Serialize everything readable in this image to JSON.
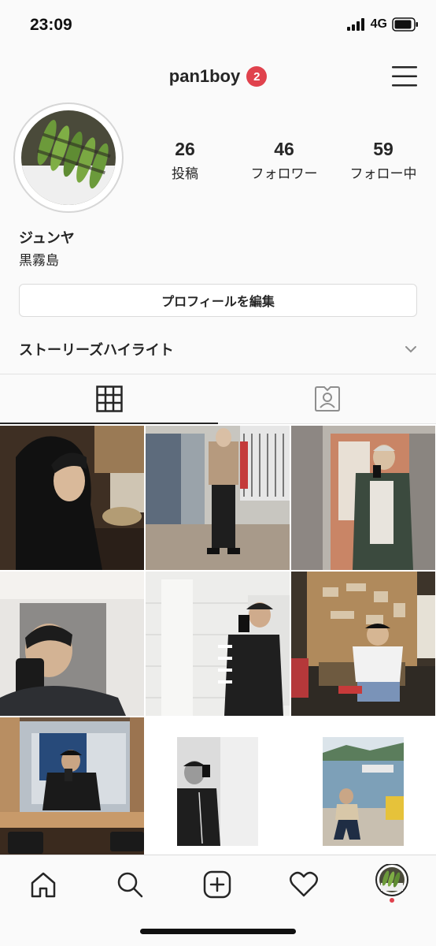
{
  "status_bar": {
    "time": "23:09",
    "network": "4G"
  },
  "header": {
    "username": "pan1boy",
    "notification_count": "2"
  },
  "profile": {
    "stats": [
      {
        "value": "26",
        "label": "投稿"
      },
      {
        "value": "46",
        "label": "フォロワー"
      },
      {
        "value": "59",
        "label": "フォロー中"
      }
    ],
    "display_name": "ジュンヤ",
    "bio": "黒霧島",
    "edit_button": "プロフィールを編集",
    "highlights_label": "ストーリーズハイライト"
  },
  "tabs": [
    {
      "icon": "grid-icon",
      "active": true
    },
    {
      "icon": "tagged-icon",
      "active": false
    }
  ],
  "bottom_nav": [
    {
      "icon": "home-icon"
    },
    {
      "icon": "search-icon"
    },
    {
      "icon": "new-post-icon"
    },
    {
      "icon": "activity-heart-icon"
    },
    {
      "icon": "profile-avatar-icon",
      "has_dot": true
    }
  ],
  "colors": {
    "badge": "#e0424d",
    "text": "#262626",
    "border": "#dbdbdb",
    "background": "#fafafa"
  }
}
